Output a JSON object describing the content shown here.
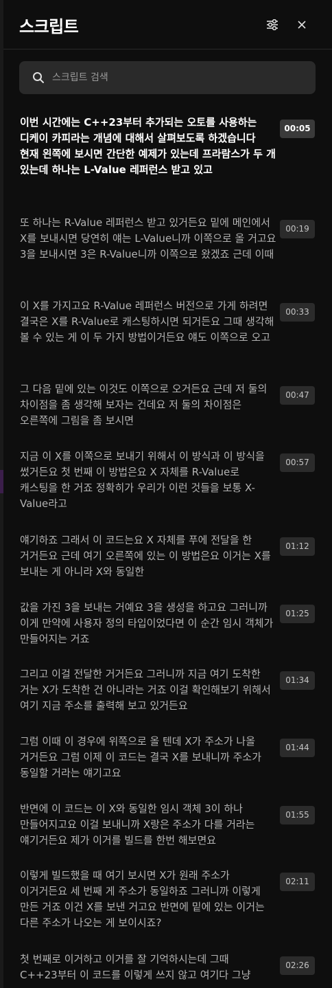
{
  "header": {
    "title": "스크립트"
  },
  "search": {
    "placeholder": "스크립트 검색"
  },
  "scripts": [
    {
      "text": "이번 시간에는 C++23부터 추가되는 오토를 사용하는 디케이 카피라는 개념에 대해서 살펴보도록 하겠습니다 현재 왼쪽에 보시면 간단한 예제가 있는데 프라람스가 두 개 있는데 하나는 L-Value 레퍼런스 받고 있고",
      "time": "00:05"
    },
    {
      "text": "또 하나는 R-Value 레퍼런스 받고 있거든요 밑에 메인에서 X를 보내시면 당연히 얘는 L-Value니까 이쪽으로 올 거고요 3을 보내시면 3은 R-Value니까 이쪽으로 왔겠죠 근데 이때",
      "time": "00:19"
    },
    {
      "text": "이 X를 가지고요 R-Value 레퍼런스 버전으로 가게 하려면 결국은 X를 R-Value로 캐스팅하시면 되거든요 그때 생각해 볼 수 있는 게 이 두 가지 방법이거든요 얘도 이쪽으로 오고",
      "time": "00:33"
    },
    {
      "text": "그 다음 밑에 있는 이것도 이쪽으로 오거든요 근데 저 둘의 차이점을 좀 생각해 보자는 건데요 저 둘의 차이점은 오른쪽에 그림을 좀 보시면",
      "time": "00:47"
    },
    {
      "text": "지금 이 X를 이쪽으로 보내기 위해서 이 방식과 이 방식을 썼거든요 첫 번째 이 방법은요 X 자체를 R-Value로 캐스팅을 한 거죠 정확히가 우리가 이런 것들을 보통 X-Value라고",
      "time": "00:57"
    },
    {
      "text": "얘기하죠 그래서 이 코드는요 X 자체를 푸에 전달을 한 거거든요 근데 여기 오른쪽에 있는 이 방법은요 이거는 X를 보내는 게 아니라 X와 동일한",
      "time": "01:12"
    },
    {
      "text": "값을 가진 3을 보내는 거예요 3을 생성을 하고요 그러니까 이게 만약에 사용자 정의 타입이었다면 이 순간 임시 객체가 만들어지는 거죠",
      "time": "01:25"
    },
    {
      "text": "그리고 이걸 전달한 거거든요 그러니까 지금 여기 도착한 거는 X가 도착한 건 아니라는 거죠 이걸 확인해보기 위해서 여기 지금 주소를 출력해 보고 있거든요",
      "time": "01:34"
    },
    {
      "text": "그럼 이때 이 경우에 위쪽으로 올 텐데 X가 주소가 나올 거거든요 그럼 이제 이 코드는 결국 X를 보내니까 주소가 동일할 거라는 얘기고요",
      "time": "01:44"
    },
    {
      "text": "반면에 이 코드는 이 X와 동일한 임시 객체 3이 하나 만들어지고요 이걸 보내니까 X랑은 주소가 다를 거라는 얘기거든요 제가 이거를 빌드를 한번 해보면요",
      "time": "01:55"
    },
    {
      "text": "이렇게 빌드했을 때 여기 보시면 X가 원래 주소가 이거거든요 세 번째 게 주소가 동일하죠 그러니까 이렇게 만든 거죠 이건 X를 보낸 거고요 반면에 밑에 있는 이거는 다른 주소가 나오는 게 보이시죠?",
      "time": "02:11"
    },
    {
      "text": "첫 번째로 이거하고 이거를 잘 기억하시는데 그때 C++23부터 이 코드를 이렇게 쓰지 않고 여기다 그냥",
      "time": "02:26"
    }
  ]
}
